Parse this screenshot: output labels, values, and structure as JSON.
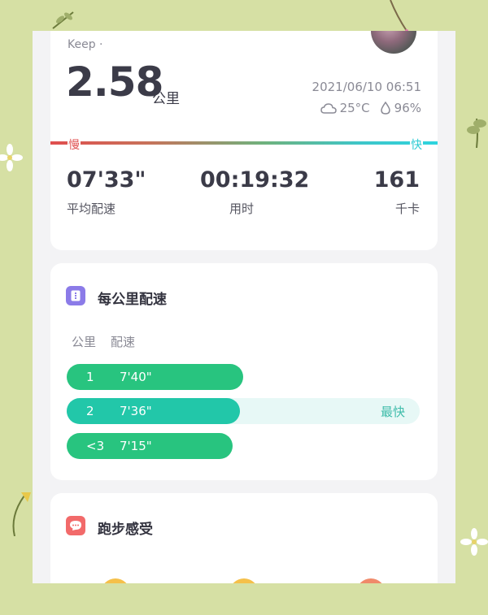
{
  "header": {
    "brand": "Keep ·"
  },
  "summary": {
    "distance": "2.58",
    "distance_unit": "公里",
    "datetime": "2021/06/10 06:51",
    "temperature": "25°C",
    "humidity": "96%",
    "pace_scale": {
      "slow_label": "慢",
      "fast_label": "快"
    }
  },
  "stats": [
    {
      "value": "07'33\"",
      "label": "平均配速"
    },
    {
      "value": "00:19:32",
      "label": "用时"
    },
    {
      "value": "161",
      "label": "千卡"
    }
  ],
  "pace_section": {
    "title": "每公里配速",
    "col_km": "公里",
    "col_pace": "配速",
    "rows": [
      {
        "km": "1",
        "pace": "7'40\"",
        "fraction": 0.5,
        "color": "#28c47f"
      },
      {
        "km": "2",
        "pace": "7'36\"",
        "fraction": 0.49,
        "color": "#22c7a9",
        "badge": "最快"
      },
      {
        "km": "<3",
        "pace": "7'15\"",
        "fraction": 0.47,
        "color": "#28c47f"
      }
    ],
    "track_color": "#e7f8f6"
  },
  "feel_section": {
    "title": "跑步感受"
  },
  "colors": {
    "background": "#d6e0a4",
    "pace_icon": "#8b7be8",
    "feel_icon": "#f26a6a"
  },
  "icons": {
    "pace_icon": "list-icon",
    "feel_icon": "smile-icon",
    "weather": "cloud-icon",
    "humidity": "droplet-icon"
  }
}
